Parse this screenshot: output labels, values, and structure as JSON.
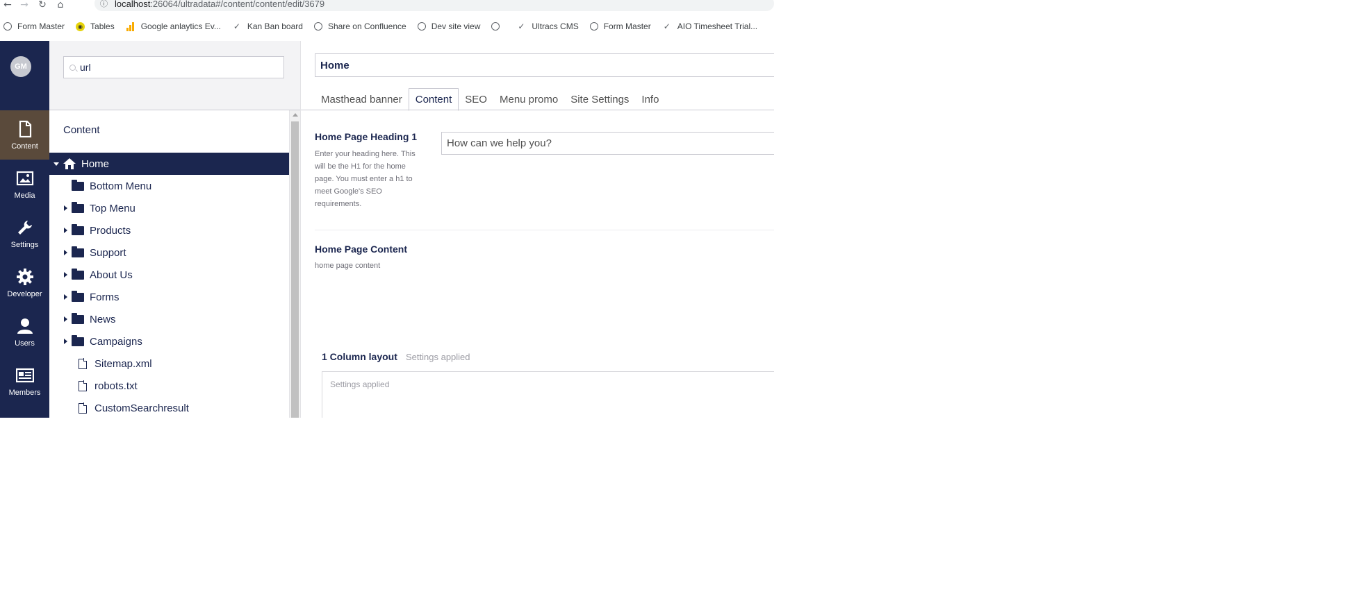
{
  "browser": {
    "back_icon": "back-arrow-icon",
    "forward_icon": "forward-arrow-icon",
    "reload_icon": "reload-icon",
    "home_icon": "home-icon",
    "url_host": "localhost",
    "url_path": ":26064/ultradata#/content/content/edit/3679",
    "bookmarks": [
      {
        "label": "Form Master",
        "icon": "globe-icon"
      },
      {
        "label": "Tables",
        "icon": "tables-icon"
      },
      {
        "label": "Google anlaytics Ev...",
        "icon": "analytics-bars-icon"
      },
      {
        "label": "Kan Ban board",
        "icon": "swoosh-icon"
      },
      {
        "label": "Share on Confluence",
        "icon": "globe-icon"
      },
      {
        "label": "Dev site view",
        "icon": "globe-icon"
      },
      {
        "label": "",
        "icon": "globe-icon"
      },
      {
        "label": "Ultracs CMS",
        "icon": "swoosh-icon"
      },
      {
        "label": "Form Master",
        "icon": "globe-icon"
      },
      {
        "label": "AIO Timesheet Trial...",
        "icon": "swoosh-icon"
      }
    ]
  },
  "rail": {
    "avatar": "GM",
    "sections": [
      {
        "label": "Content",
        "icon": "document-icon",
        "active": true
      },
      {
        "label": "Media",
        "icon": "image-icon",
        "active": false
      },
      {
        "label": "Settings",
        "icon": "wrench-icon",
        "active": false
      },
      {
        "label": "Developer",
        "icon": "cog-icon",
        "active": false
      },
      {
        "label": "Users",
        "icon": "user-icon",
        "active": false
      },
      {
        "label": "Members",
        "icon": "id-card-icon",
        "active": false
      }
    ]
  },
  "tree": {
    "search_value": "url",
    "title": "Content",
    "items": [
      {
        "label": "Home",
        "icon": "home-icon",
        "expander": "expanded"
      },
      {
        "label": "Bottom Menu",
        "icon": "folder-icon",
        "expander": "none"
      },
      {
        "label": "Top Menu",
        "icon": "folder-icon",
        "expander": "collapsed"
      },
      {
        "label": "Products",
        "icon": "folder-icon",
        "expander": "collapsed"
      },
      {
        "label": "Support",
        "icon": "folder-icon",
        "expander": "collapsed"
      },
      {
        "label": "About Us",
        "icon": "folder-icon",
        "expander": "collapsed"
      },
      {
        "label": "Forms",
        "icon": "folder-icon",
        "expander": "collapsed"
      },
      {
        "label": "News",
        "icon": "folder-icon",
        "expander": "collapsed"
      },
      {
        "label": "Campaigns",
        "icon": "folder-icon",
        "expander": "collapsed"
      },
      {
        "label": "Sitemap.xml",
        "icon": "document-icon",
        "expander": "none"
      },
      {
        "label": "robots.txt",
        "icon": "document-icon",
        "expander": "none"
      },
      {
        "label": "CustomSearchresult",
        "icon": "document-icon",
        "expander": "none"
      }
    ]
  },
  "editor": {
    "node_name": "Home",
    "tabs": [
      "Masthead banner",
      "Content",
      "SEO",
      "Menu promo",
      "Site Settings",
      "Info"
    ],
    "active_tab": "Content",
    "heading_label": "Home Page Heading 1",
    "heading_desc": "Enter your heading here. This will be the H1 for the home page. You must enter a h1 to meet Google's SEO requirements.",
    "heading_value": "How can we help you?",
    "content_label": "Home Page Content",
    "content_desc": "home page content",
    "layout_title": "1 Column layout",
    "layout_sub": "Settings applied",
    "layout_box_text": "Settings applied"
  },
  "colors": {
    "navy": "#1b264f",
    "active_section": "#5a4a3b",
    "panel_bg": "#f3f3f5",
    "border": "#c9c9d1"
  }
}
